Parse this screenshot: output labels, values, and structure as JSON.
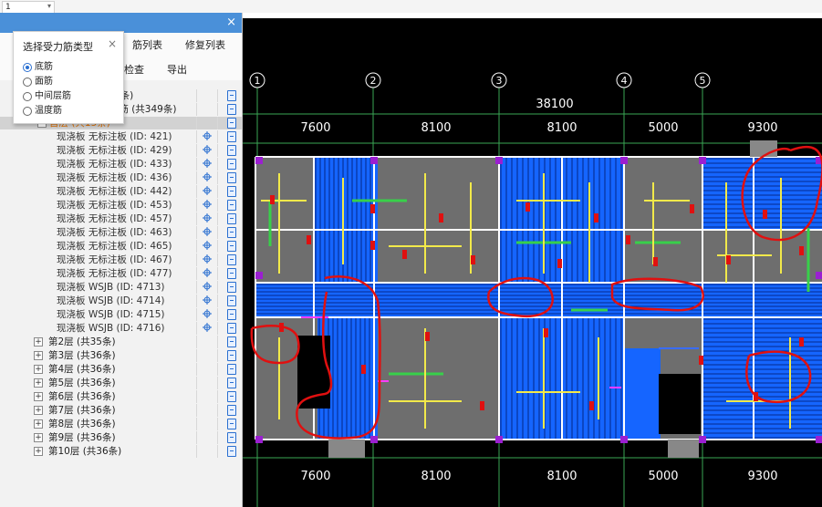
{
  "floor_select": {
    "value": "1"
  },
  "panel": {
    "tabs": [
      "筋列表",
      "修复列表"
    ],
    "tools": [
      "检查",
      "导出"
    ],
    "close": "×"
  },
  "popup": {
    "title": "选择受力筋类型",
    "close": "×",
    "options": [
      "底筋",
      "面筋",
      "中间层筋",
      "温度筋"
    ],
    "selected": 0
  },
  "tree": {
    "partial_row": "6条)",
    "board_group": "板 (筏板) 未布置钢筋 (共349条)",
    "first_floor": "首层 (共15条)",
    "items": [
      "现浇板 无标注板 (ID: 421)",
      "现浇板 无标注板 (ID: 429)",
      "现浇板 无标注板 (ID: 433)",
      "现浇板 无标注板 (ID: 436)",
      "现浇板 无标注板 (ID: 442)",
      "现浇板 无标注板 (ID: 453)",
      "现浇板 无标注板 (ID: 457)",
      "现浇板 无标注板 (ID: 463)",
      "现浇板 无标注板 (ID: 465)",
      "现浇板 无标注板 (ID: 467)",
      "现浇板 无标注板 (ID: 477)",
      "现浇板 WSJB (ID: 4713)",
      "现浇板 WSJB (ID: 4714)",
      "现浇板 WSJB (ID: 4715)",
      "现浇板 WSJB (ID: 4716)"
    ],
    "floors": [
      "第2层 (共35条)",
      "第3层 (共36条)",
      "第4层 (共36条)",
      "第5层 (共36条)",
      "第6层 (共36条)",
      "第7层 (共36条)",
      "第8层 (共36条)",
      "第9层 (共36条)",
      "第10层 (共36条)"
    ]
  },
  "cad": {
    "axes": [
      "1",
      "2",
      "3",
      "4",
      "5"
    ],
    "total_dim": "38100",
    "top_dims": [
      "7600",
      "8100",
      "8100",
      "5000",
      "9300"
    ],
    "bottom_dims": [
      "7600",
      "8100",
      "8100",
      "5000",
      "9300"
    ],
    "colors": {
      "background": "#000000",
      "rebar": "#1565ff",
      "slab": "#6e6e6e",
      "beam": "#ffffff",
      "markup": "#e01010",
      "support": "#f2e94a",
      "column": "#9b1fd1"
    }
  }
}
